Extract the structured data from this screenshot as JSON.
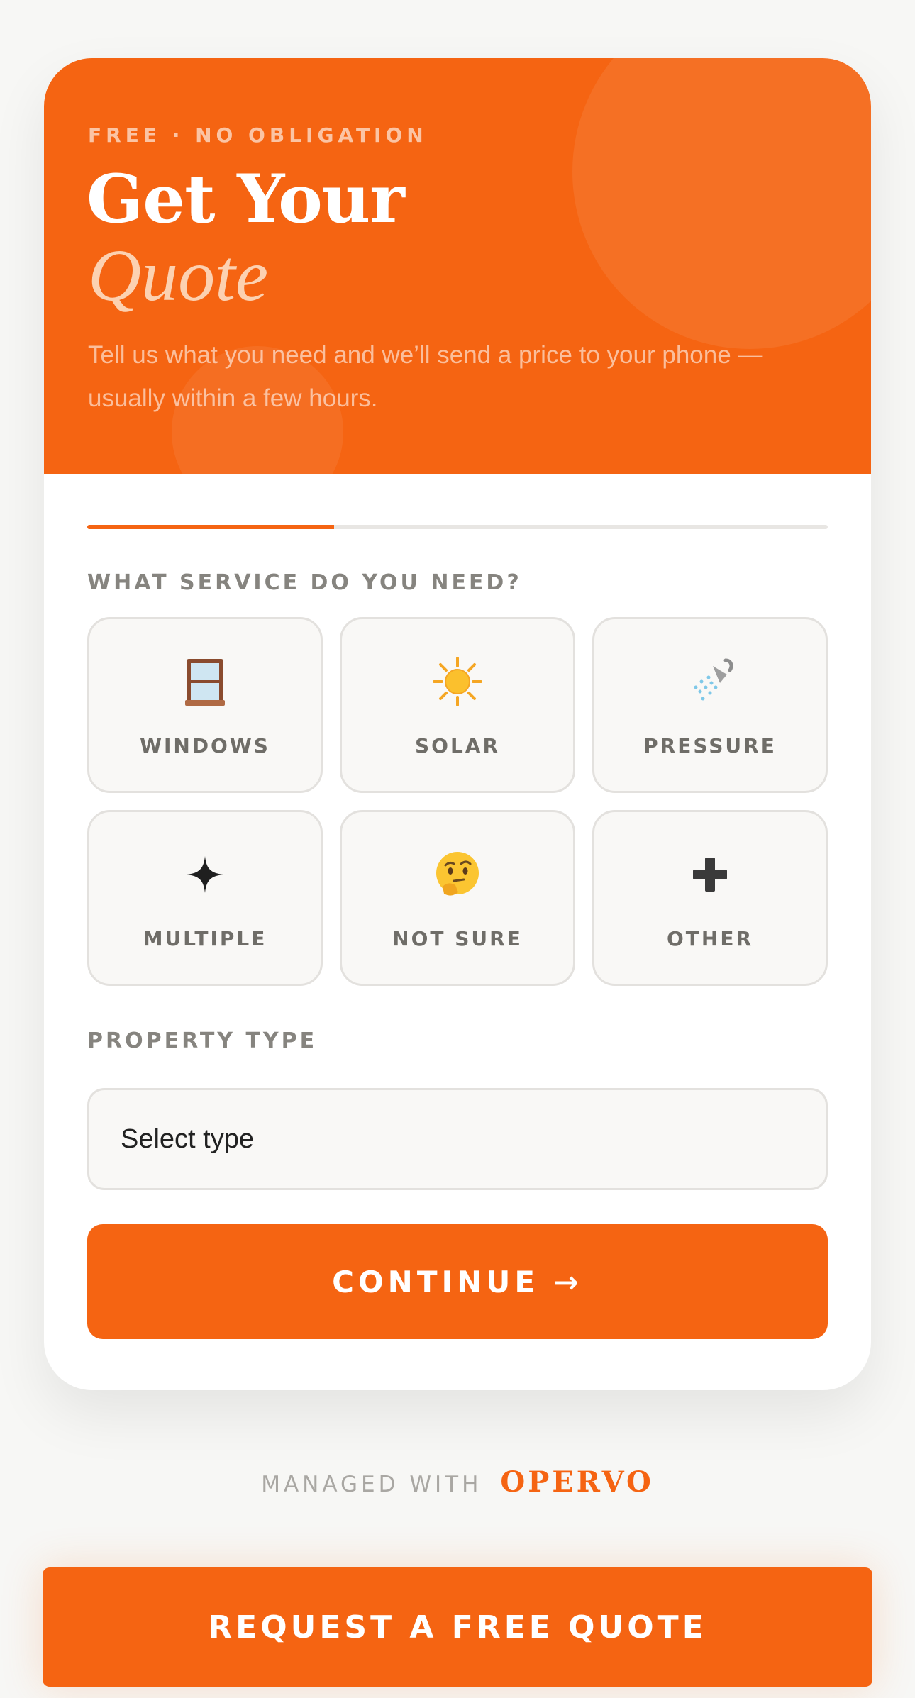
{
  "hero": {
    "eyebrow": "FREE · NO OBLIGATION",
    "title_line1": "Get Your",
    "title_line2": "Quote",
    "subtitle": "Tell us what you need and we’ll send a price to your phone — usually within a few hours."
  },
  "progress": {
    "value": 0.333
  },
  "service": {
    "label": "WHAT SERVICE DO YOU NEED?",
    "options": [
      {
        "label": "WINDOWS",
        "icon": "window-icon"
      },
      {
        "label": "SOLAR",
        "icon": "sun-icon"
      },
      {
        "label": "PRESSURE",
        "icon": "shower-icon"
      },
      {
        "label": "MULTIPLE",
        "icon": "sparkle-icon"
      },
      {
        "label": "NOT SURE",
        "icon": "thinking-face-icon"
      },
      {
        "label": "OTHER",
        "icon": "plus-icon"
      }
    ]
  },
  "property": {
    "label": "PROPERTY TYPE",
    "selected": "Select type"
  },
  "continue_label": "CONTINUE →",
  "footer": {
    "managed_with": "MANAGED WITH",
    "brand": "OPERVO"
  },
  "cta_label": "REQUEST A FREE QUOTE",
  "colors": {
    "accent": "#f56412",
    "background": "#f7f7f5"
  }
}
